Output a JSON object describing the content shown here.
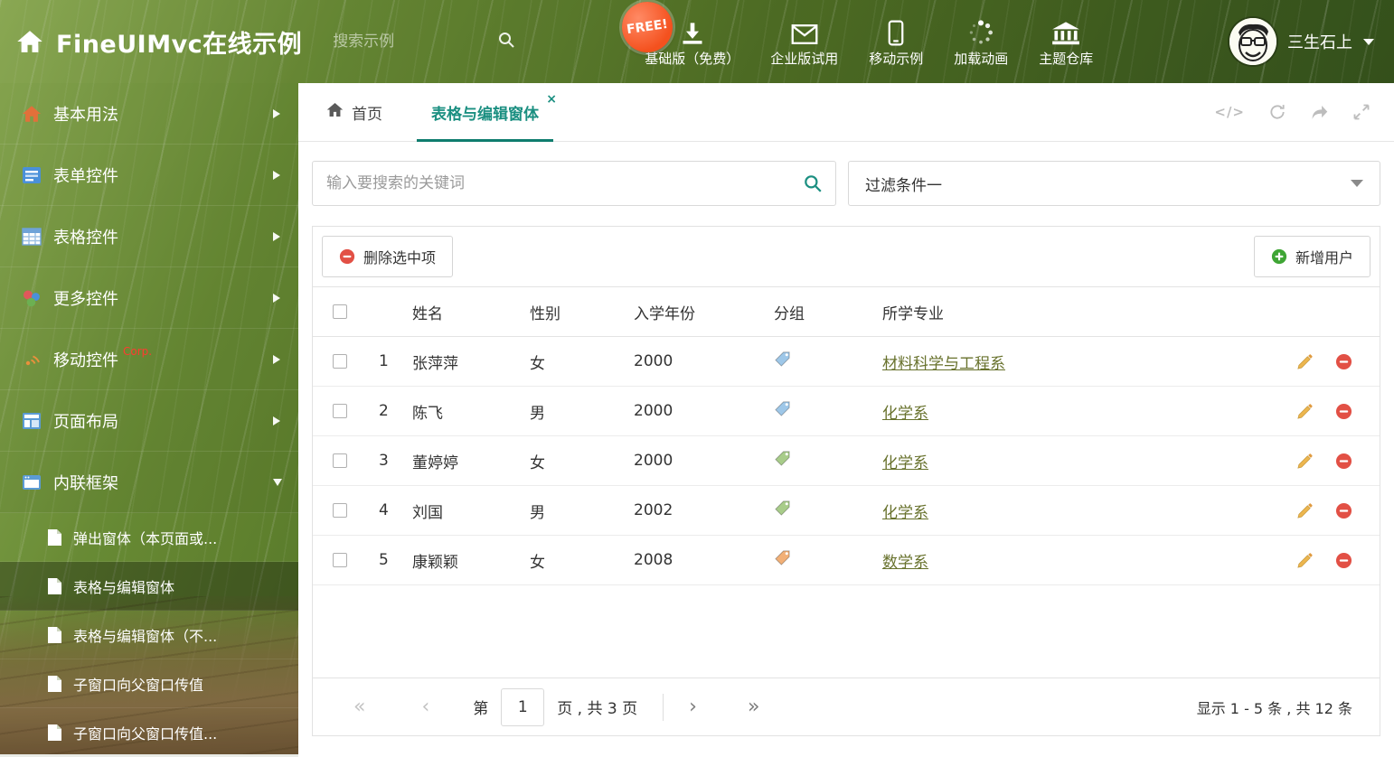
{
  "colors": {
    "accent_teal": "#1b8f81",
    "tab_underline": "#0f7d6e",
    "link_olive": "#68722d",
    "free_badge_orange": "#f4511e",
    "delete_red": "#e25045",
    "add_green": "#3fa535",
    "pencil_orange": "#edb64e",
    "corp_badge_red": "#ff3b30"
  },
  "header": {
    "title": "FineUIMvc在线示例",
    "search_placeholder": "搜索示例",
    "free_badge": "FREE!",
    "nav_items": [
      {
        "label": "基础版（免费）",
        "icon": "download-icon"
      },
      {
        "label": "企业版试用",
        "icon": "envelope-icon"
      },
      {
        "label": "移动示例",
        "icon": "mobile-icon"
      },
      {
        "label": "加载动画",
        "icon": "spinner-icon"
      },
      {
        "label": "主题仓库",
        "icon": "bank-icon"
      }
    ],
    "user_name": "三生石上"
  },
  "sidebar": {
    "items": [
      {
        "label": "基本用法"
      },
      {
        "label": "表单控件"
      },
      {
        "label": "表格控件"
      },
      {
        "label": "更多控件"
      },
      {
        "label": "移动控件",
        "badge": "Corp."
      },
      {
        "label": "页面布局"
      },
      {
        "label": "内联框架"
      }
    ],
    "subitems": [
      {
        "label": "弹出窗体（本页面或..."
      },
      {
        "label": "表格与编辑窗体"
      },
      {
        "label": "表格与编辑窗体（不..."
      },
      {
        "label": "子窗口向父窗口传值"
      },
      {
        "label": "子窗口向父窗口传值..."
      }
    ]
  },
  "main": {
    "tabs": {
      "home": "首页",
      "active": "表格与编辑窗体",
      "close": "×"
    },
    "tools": {
      "code": "</>"
    },
    "filter": {
      "search_placeholder": "输入要搜索的关键词",
      "dropdown_value": "过滤条件一"
    },
    "toolbar": {
      "delete_label": "删除选中项",
      "add_label": "新增用户"
    },
    "table": {
      "headers": {
        "name": "姓名",
        "gender": "性别",
        "year": "入学年份",
        "group": "分组",
        "major": "所学专业"
      },
      "rows": [
        {
          "num": "1",
          "name": "张萍萍",
          "gender": "女",
          "year": "2000",
          "tag_color": "#9ec7e8",
          "major": "材料科学与工程系"
        },
        {
          "num": "2",
          "name": "陈飞",
          "gender": "男",
          "year": "2000",
          "tag_color": "#9ec7e8",
          "major": "化学系"
        },
        {
          "num": "3",
          "name": "董婷婷",
          "gender": "女",
          "year": "2000",
          "tag_color": "#a8cc8a",
          "major": "化学系"
        },
        {
          "num": "4",
          "name": "刘国",
          "gender": "男",
          "year": "2002",
          "tag_color": "#a8cc8a",
          "major": "化学系"
        },
        {
          "num": "5",
          "name": "康颖颖",
          "gender": "女",
          "year": "2008",
          "tag_color": "#f2b077",
          "major": "数学系"
        }
      ]
    },
    "pagination": {
      "prefix": "第",
      "page_value": "1",
      "suffix": "页 , 共 3 页",
      "icons": {
        "first": "«",
        "prev": "‹",
        "next": "›",
        "last": "»"
      },
      "summary": "显示 1 - 5 条 , 共 12 条"
    }
  }
}
